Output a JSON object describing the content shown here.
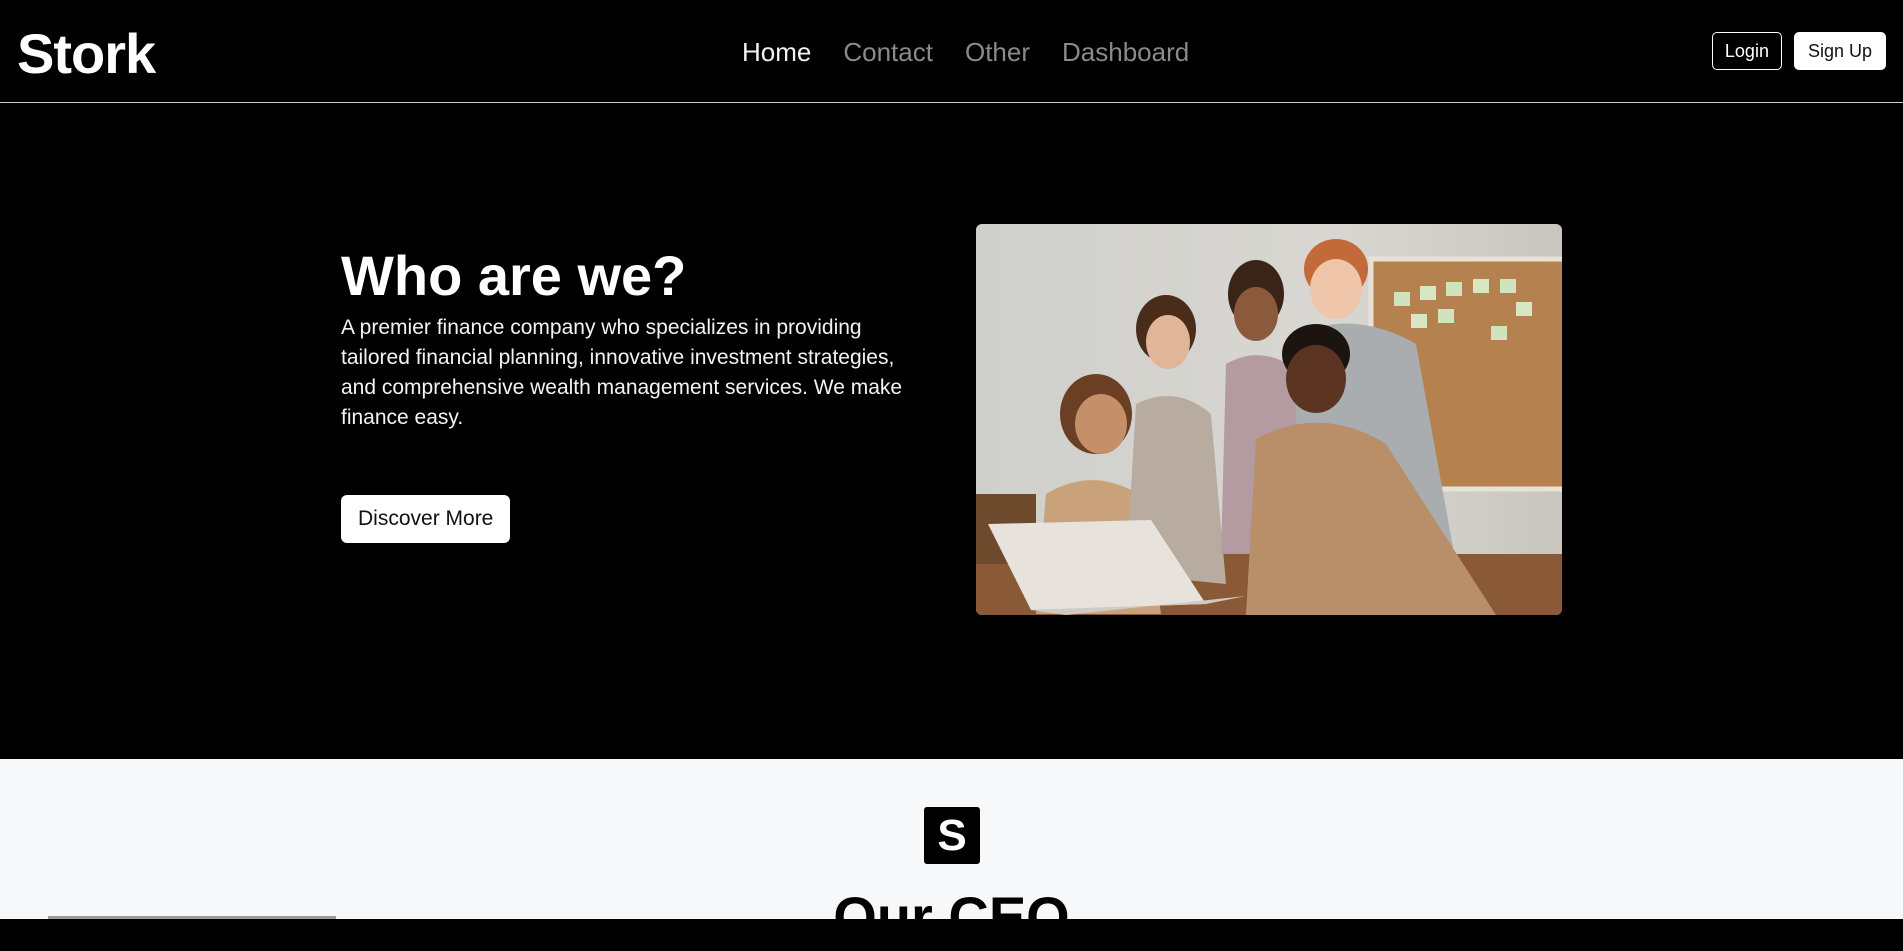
{
  "brand": {
    "name": "Stork"
  },
  "nav": {
    "items": [
      {
        "label": "Home",
        "active": true
      },
      {
        "label": "Contact",
        "active": false
      },
      {
        "label": "Other",
        "active": false
      },
      {
        "label": "Dashboard",
        "active": false
      }
    ]
  },
  "auth": {
    "login_label": "Login",
    "signup_label": "Sign Up"
  },
  "hero": {
    "title": "Who are we?",
    "description": "A premier finance company who specializes in providing tailored financial planning, innovative investment strategies, and comprehensive wealth management services. We make finance easy.",
    "cta_label": "Discover More",
    "image_icon": "team-photo"
  },
  "about": {
    "logo_letter": "S",
    "title": "Our CEO"
  },
  "colors": {
    "background": "#000000",
    "nav_inactive": "#8a8a8a",
    "section_light": "#f7f8fa"
  }
}
